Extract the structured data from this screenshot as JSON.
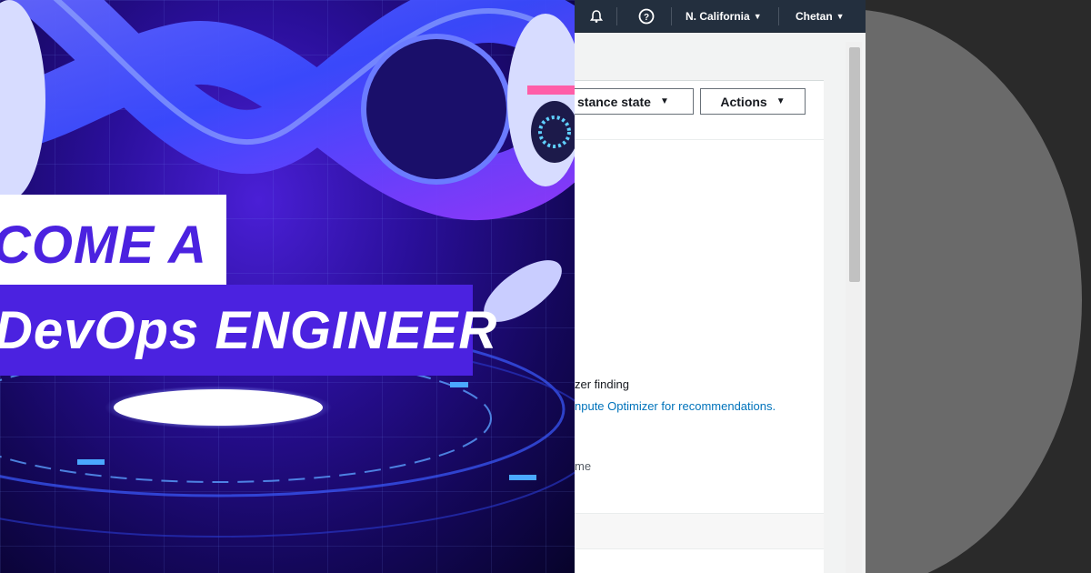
{
  "banner": {
    "line1": "COME A",
    "line2": "DevOps ENGINEER"
  },
  "topbar": {
    "bell_icon": "bell-icon",
    "help_icon": "help-circle-icon",
    "region": "N. California",
    "user": "Chetan",
    "caret": "▼"
  },
  "toolbar": {
    "instance_state_label": "stance state",
    "actions_label": "Actions",
    "dropdown_glyph": "▼"
  },
  "details": {
    "optimizer_label": "zer finding",
    "optimizer_link": "npute Optimizer for recommendations.",
    "name_label": "me"
  },
  "colors": {
    "banner_accent": "#4b22e0",
    "console_topbar": "#232f3e",
    "link": "#0073bb"
  }
}
